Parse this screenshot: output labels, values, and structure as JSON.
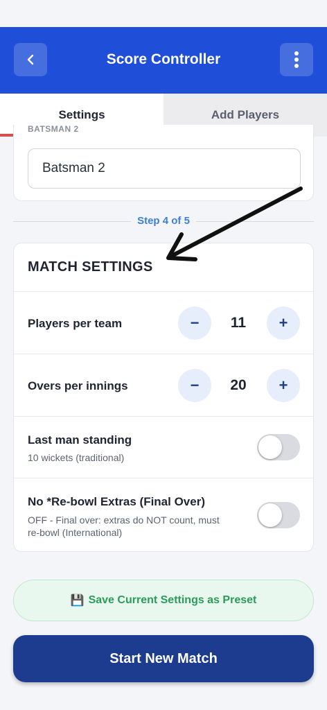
{
  "colors": {
    "app_bar": "#1f4fd8",
    "tab_indicator": "#e04a4a",
    "step_text": "#3b7fd6",
    "stepper_bg": "#e7eefb",
    "preset_bg": "#e9f8ef",
    "preset_text": "#2b9b5a",
    "start_button": "#1e3c8f"
  },
  "app_bar": {
    "title": "Score Controller",
    "back_icon": "chevron-left-icon",
    "more_icon": "more-vertical-icon"
  },
  "tabs": [
    {
      "label": "Settings",
      "active": true
    },
    {
      "label": "Add Players",
      "active": false
    }
  ],
  "batsman_card": {
    "label_cut": "BATSMAN 2",
    "input_value": "Batsman 2"
  },
  "step": {
    "text": "Step 4 of 5"
  },
  "match_settings": {
    "heading": "MATCH SETTINGS",
    "players_per_team": {
      "label": "Players per team",
      "value": "11",
      "minus": "−",
      "plus": "+"
    },
    "overs_per_innings": {
      "label": "Overs per innings",
      "value": "20",
      "minus": "−",
      "plus": "+"
    },
    "last_man_standing": {
      "label": "Last man standing",
      "sub": "10 wickets (traditional)",
      "on": false
    },
    "no_rebowl": {
      "label": "No *Re-bowl Extras (Final Over)",
      "sub_line1": "OFF - Final over: extras do NOT count, must",
      "sub_line2": "re-bowl (International)",
      "on": false
    }
  },
  "preset_button": {
    "icon": "floppy-disk-icon",
    "emoji": "💾",
    "label": "Save Current Settings as Preset"
  },
  "start_button": {
    "label": "Start New Match"
  }
}
